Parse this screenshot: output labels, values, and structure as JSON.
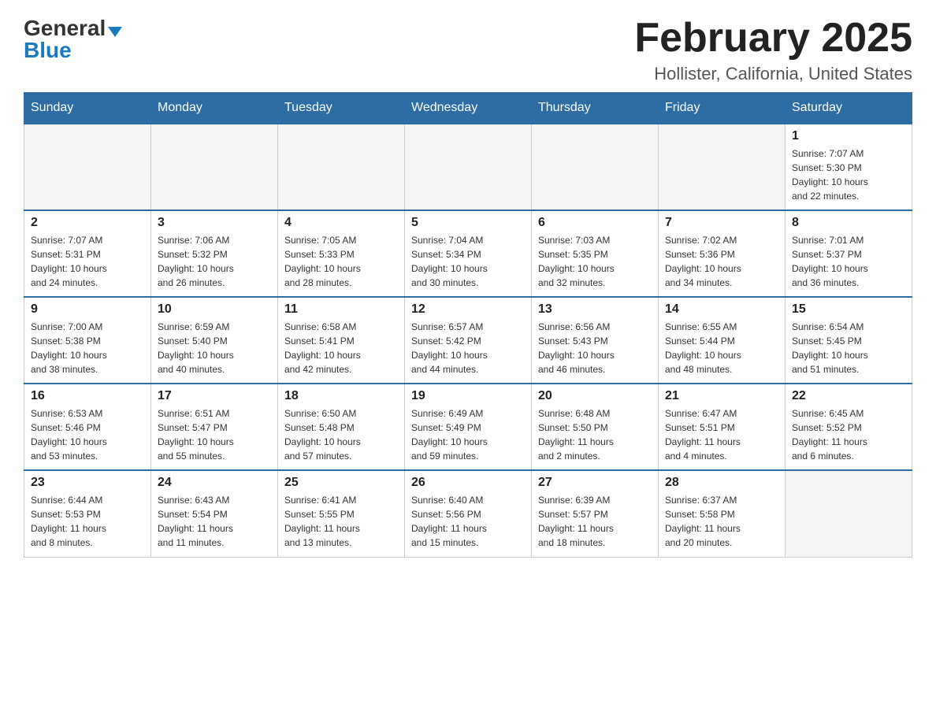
{
  "header": {
    "logo_general": "General",
    "logo_blue": "Blue",
    "title": "February 2025",
    "subtitle": "Hollister, California, United States"
  },
  "days_of_week": [
    "Sunday",
    "Monday",
    "Tuesday",
    "Wednesday",
    "Thursday",
    "Friday",
    "Saturday"
  ],
  "weeks": [
    {
      "days": [
        {
          "num": "",
          "info": ""
        },
        {
          "num": "",
          "info": ""
        },
        {
          "num": "",
          "info": ""
        },
        {
          "num": "",
          "info": ""
        },
        {
          "num": "",
          "info": ""
        },
        {
          "num": "",
          "info": ""
        },
        {
          "num": "1",
          "info": "Sunrise: 7:07 AM\nSunset: 5:30 PM\nDaylight: 10 hours\nand 22 minutes."
        }
      ]
    },
    {
      "days": [
        {
          "num": "2",
          "info": "Sunrise: 7:07 AM\nSunset: 5:31 PM\nDaylight: 10 hours\nand 24 minutes."
        },
        {
          "num": "3",
          "info": "Sunrise: 7:06 AM\nSunset: 5:32 PM\nDaylight: 10 hours\nand 26 minutes."
        },
        {
          "num": "4",
          "info": "Sunrise: 7:05 AM\nSunset: 5:33 PM\nDaylight: 10 hours\nand 28 minutes."
        },
        {
          "num": "5",
          "info": "Sunrise: 7:04 AM\nSunset: 5:34 PM\nDaylight: 10 hours\nand 30 minutes."
        },
        {
          "num": "6",
          "info": "Sunrise: 7:03 AM\nSunset: 5:35 PM\nDaylight: 10 hours\nand 32 minutes."
        },
        {
          "num": "7",
          "info": "Sunrise: 7:02 AM\nSunset: 5:36 PM\nDaylight: 10 hours\nand 34 minutes."
        },
        {
          "num": "8",
          "info": "Sunrise: 7:01 AM\nSunset: 5:37 PM\nDaylight: 10 hours\nand 36 minutes."
        }
      ]
    },
    {
      "days": [
        {
          "num": "9",
          "info": "Sunrise: 7:00 AM\nSunset: 5:38 PM\nDaylight: 10 hours\nand 38 minutes."
        },
        {
          "num": "10",
          "info": "Sunrise: 6:59 AM\nSunset: 5:40 PM\nDaylight: 10 hours\nand 40 minutes."
        },
        {
          "num": "11",
          "info": "Sunrise: 6:58 AM\nSunset: 5:41 PM\nDaylight: 10 hours\nand 42 minutes."
        },
        {
          "num": "12",
          "info": "Sunrise: 6:57 AM\nSunset: 5:42 PM\nDaylight: 10 hours\nand 44 minutes."
        },
        {
          "num": "13",
          "info": "Sunrise: 6:56 AM\nSunset: 5:43 PM\nDaylight: 10 hours\nand 46 minutes."
        },
        {
          "num": "14",
          "info": "Sunrise: 6:55 AM\nSunset: 5:44 PM\nDaylight: 10 hours\nand 48 minutes."
        },
        {
          "num": "15",
          "info": "Sunrise: 6:54 AM\nSunset: 5:45 PM\nDaylight: 10 hours\nand 51 minutes."
        }
      ]
    },
    {
      "days": [
        {
          "num": "16",
          "info": "Sunrise: 6:53 AM\nSunset: 5:46 PM\nDaylight: 10 hours\nand 53 minutes."
        },
        {
          "num": "17",
          "info": "Sunrise: 6:51 AM\nSunset: 5:47 PM\nDaylight: 10 hours\nand 55 minutes."
        },
        {
          "num": "18",
          "info": "Sunrise: 6:50 AM\nSunset: 5:48 PM\nDaylight: 10 hours\nand 57 minutes."
        },
        {
          "num": "19",
          "info": "Sunrise: 6:49 AM\nSunset: 5:49 PM\nDaylight: 10 hours\nand 59 minutes."
        },
        {
          "num": "20",
          "info": "Sunrise: 6:48 AM\nSunset: 5:50 PM\nDaylight: 11 hours\nand 2 minutes."
        },
        {
          "num": "21",
          "info": "Sunrise: 6:47 AM\nSunset: 5:51 PM\nDaylight: 11 hours\nand 4 minutes."
        },
        {
          "num": "22",
          "info": "Sunrise: 6:45 AM\nSunset: 5:52 PM\nDaylight: 11 hours\nand 6 minutes."
        }
      ]
    },
    {
      "days": [
        {
          "num": "23",
          "info": "Sunrise: 6:44 AM\nSunset: 5:53 PM\nDaylight: 11 hours\nand 8 minutes."
        },
        {
          "num": "24",
          "info": "Sunrise: 6:43 AM\nSunset: 5:54 PM\nDaylight: 11 hours\nand 11 minutes."
        },
        {
          "num": "25",
          "info": "Sunrise: 6:41 AM\nSunset: 5:55 PM\nDaylight: 11 hours\nand 13 minutes."
        },
        {
          "num": "26",
          "info": "Sunrise: 6:40 AM\nSunset: 5:56 PM\nDaylight: 11 hours\nand 15 minutes."
        },
        {
          "num": "27",
          "info": "Sunrise: 6:39 AM\nSunset: 5:57 PM\nDaylight: 11 hours\nand 18 minutes."
        },
        {
          "num": "28",
          "info": "Sunrise: 6:37 AM\nSunset: 5:58 PM\nDaylight: 11 hours\nand 20 minutes."
        },
        {
          "num": "",
          "info": ""
        }
      ]
    }
  ]
}
